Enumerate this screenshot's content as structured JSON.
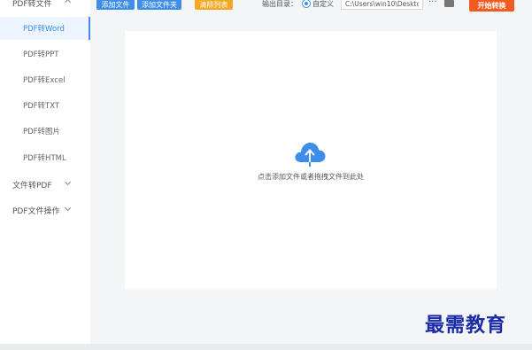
{
  "sidebar": {
    "group_pdf_to_file": "PDF转文件",
    "items": [
      {
        "label": "PDF转Word",
        "active": true
      },
      {
        "label": "PDF转PPT",
        "active": false
      },
      {
        "label": "PDF转Excel",
        "active": false
      },
      {
        "label": "PDF转TXT",
        "active": false
      },
      {
        "label": "PDF转图片",
        "active": false
      },
      {
        "label": "PDF转HTML",
        "active": false
      }
    ],
    "group_file_to_pdf": "文件转PDF",
    "group_pdf_ops": "PDF文件操作"
  },
  "toolbar": {
    "add_file": "添加文件",
    "add_folder": "添加文件夹",
    "clear_list": "清除列表",
    "output_dir_label": "输出目录：",
    "custom_option": "自定义",
    "output_path": "C:\\Users\\win10\\Deskto",
    "browse": "···",
    "start_convert": "开始转换"
  },
  "dropzone": {
    "hint": "点击添加文件或者拖拽文件到此处"
  },
  "watermark": "最需教育",
  "colors": {
    "accent": "#3d8eea",
    "orange": "#f5a623",
    "convert": "#f25a1f",
    "watermark": "#1a2ba8"
  }
}
